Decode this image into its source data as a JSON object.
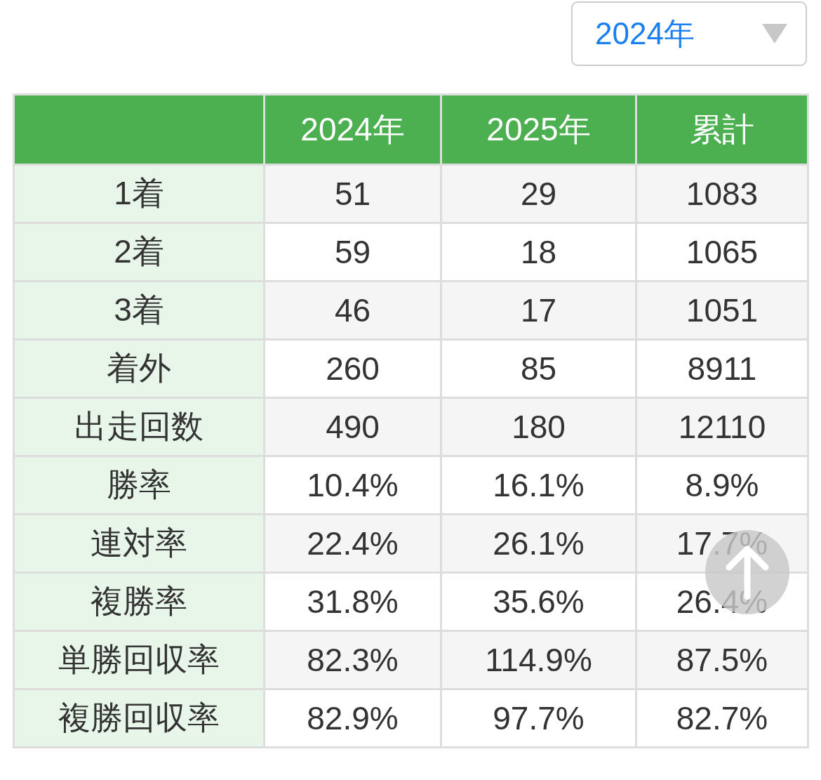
{
  "year_select": {
    "value": "2024年"
  },
  "table": {
    "columns": [
      "2024年",
      "2025年",
      "累計"
    ],
    "rows": [
      {
        "label": "1着",
        "values": [
          "51",
          "29",
          "1083"
        ]
      },
      {
        "label": "2着",
        "values": [
          "59",
          "18",
          "1065"
        ]
      },
      {
        "label": "3着",
        "values": [
          "46",
          "17",
          "1051"
        ]
      },
      {
        "label": "着外",
        "values": [
          "260",
          "85",
          "8911"
        ]
      },
      {
        "label": "出走回数",
        "values": [
          "490",
          "180",
          "12110"
        ]
      },
      {
        "label": "勝率",
        "values": [
          "10.4%",
          "16.1%",
          "8.9%"
        ]
      },
      {
        "label": "連対率",
        "values": [
          "22.4%",
          "26.1%",
          "17.7%"
        ]
      },
      {
        "label": "複勝率",
        "values": [
          "31.8%",
          "35.6%",
          "26.4%"
        ]
      },
      {
        "label": "単勝回収率",
        "values": [
          "82.3%",
          "114.9%",
          "87.5%"
        ]
      },
      {
        "label": "複勝回収率",
        "values": [
          "82.9%",
          "97.7%",
          "82.7%"
        ]
      }
    ]
  }
}
